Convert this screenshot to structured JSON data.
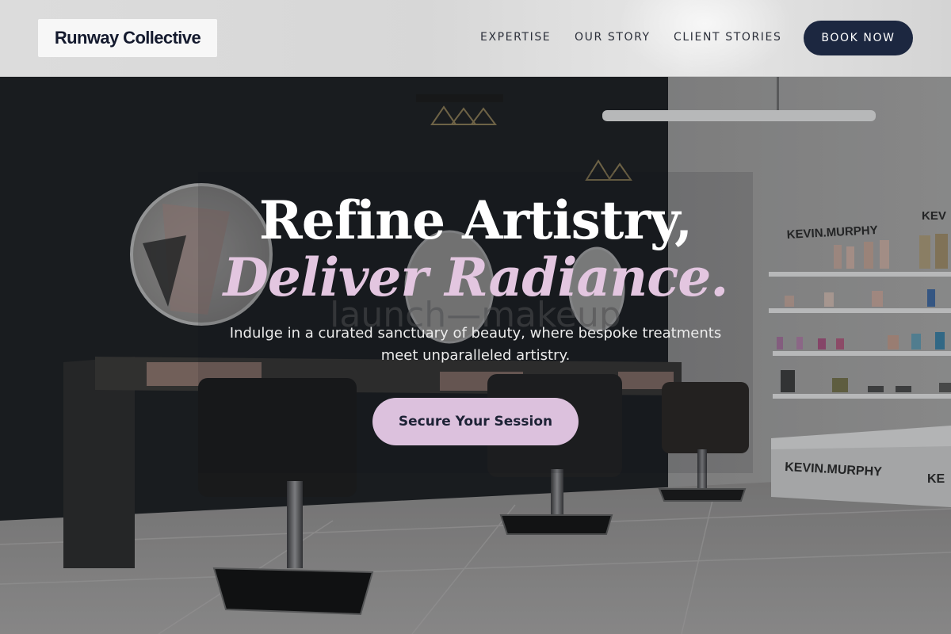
{
  "header": {
    "logo_text": "Runway Collective",
    "nav": [
      {
        "label": "EXPERTISE"
      },
      {
        "label": "OUR STORY"
      },
      {
        "label": "CLIENT STORIES"
      }
    ],
    "book_label": "BOOK NOW"
  },
  "hero": {
    "headline_line1": "Refine Artistry,",
    "headline_line2": "Deliver Radiance.",
    "subtext": "Indulge in a curated sanctuary of beauty, where bespoke treatments meet unparalleled artistry.",
    "cta_label": "Secure Your Session"
  },
  "background": {
    "wall_signage": "launch—makeup",
    "shelf_brand_1": "KEVIN.MURPHY",
    "shelf_brand_2": "KEV",
    "counter_brand_1": "KEVIN.MURPHY",
    "counter_brand_2": "KE"
  },
  "colors": {
    "nav_bg": "#dcdcdc",
    "logo_text": "#141a2e",
    "book_btn_bg": "#1c2740",
    "accent_lilac": "#dcc1dd",
    "headline_italic": "#e3c6e0"
  }
}
